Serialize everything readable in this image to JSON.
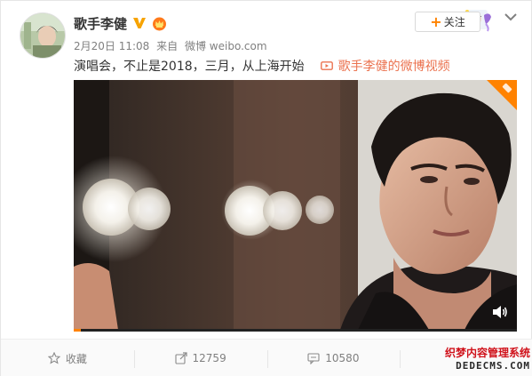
{
  "post": {
    "author": "歌手李健",
    "date": "2月20日 11:08",
    "source_prefix": "来自",
    "source": "微博 weibo.com",
    "text": "演唱会，不止是2018，三月，从上海开始",
    "video_link_label": "歌手李健的微博视频"
  },
  "header": {
    "follow_label": "关注",
    "follow_plus": "+"
  },
  "actions": [
    {
      "label": "收藏",
      "icon": "star-icon"
    },
    {
      "label": "12759",
      "icon": "share-icon"
    },
    {
      "label": "10580",
      "icon": "comment-icon"
    },
    {
      "label": "",
      "icon": "like-icon"
    }
  ],
  "watermark": {
    "line1": "织梦内容管理系统",
    "line2": "DEDECMS.COM"
  },
  "colors": {
    "accent": "#ff8200",
    "link": "#eb7350",
    "verified": "#f7a300"
  }
}
